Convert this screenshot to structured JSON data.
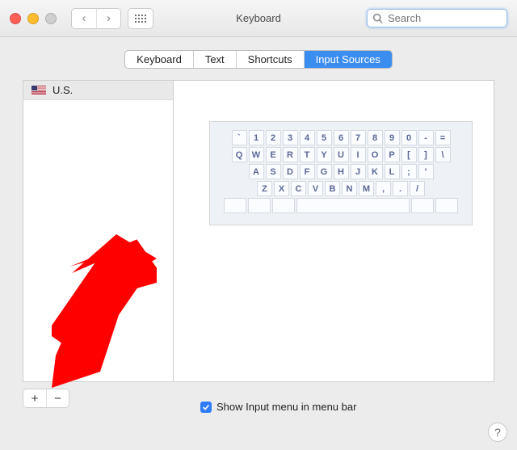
{
  "window": {
    "title": "Keyboard"
  },
  "search": {
    "placeholder": "Search",
    "value": ""
  },
  "tabs": [
    {
      "label": "Keyboard"
    },
    {
      "label": "Text"
    },
    {
      "label": "Shortcuts"
    },
    {
      "label": "Input Sources",
      "active": true
    }
  ],
  "sources": [
    {
      "flag": "us",
      "name": "U.S."
    }
  ],
  "keyboard_preview": {
    "rows": [
      [
        "`",
        "1",
        "2",
        "3",
        "4",
        "5",
        "6",
        "7",
        "8",
        "9",
        "0",
        "-",
        "="
      ],
      [
        "Q",
        "W",
        "E",
        "R",
        "T",
        "Y",
        "U",
        "I",
        "O",
        "P",
        "[",
        "]",
        "\\"
      ],
      [
        "A",
        "S",
        "D",
        "F",
        "G",
        "H",
        "J",
        "K",
        "L",
        ";",
        "'"
      ],
      [
        "Z",
        "X",
        "C",
        "V",
        "B",
        "N",
        "M",
        ",",
        ".",
        "/"
      ]
    ]
  },
  "buttons": {
    "add": "+",
    "remove": "−"
  },
  "checkbox": {
    "label": "Show Input menu in menu bar",
    "checked": true
  },
  "help": {
    "label": "?"
  }
}
